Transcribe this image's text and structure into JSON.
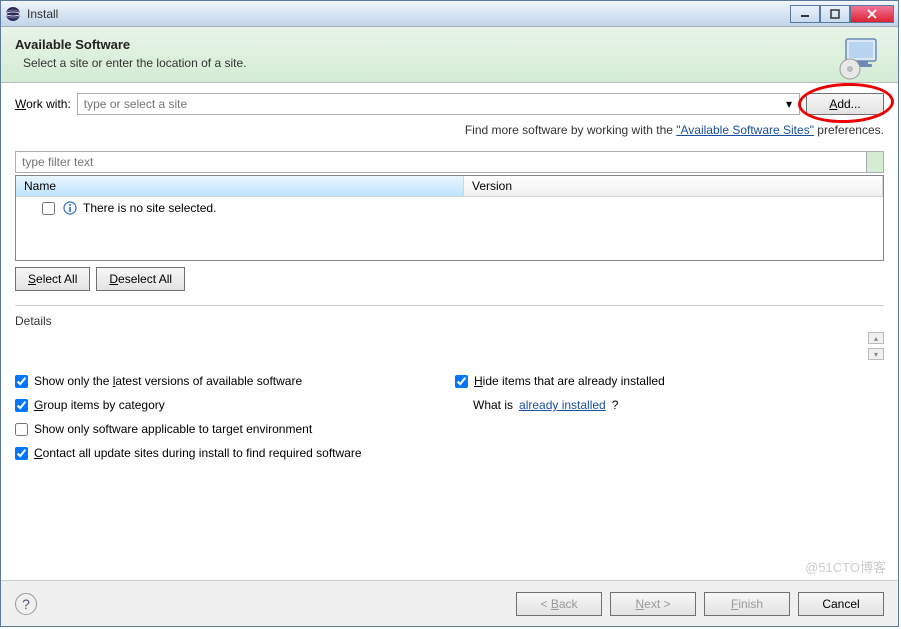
{
  "titlebar": {
    "title": "Install"
  },
  "header": {
    "title": "Available Software",
    "subtitle": "Select a site or enter the location of a site."
  },
  "workwith": {
    "label_pre": "W",
    "label_post": "ork with:",
    "placeholder": "type or select a site",
    "add_pre": "A",
    "add_post": "dd..."
  },
  "tip": {
    "pre": "Find more software by working with the ",
    "link": "\"Available Software Sites\"",
    "post": " preferences."
  },
  "filter": {
    "placeholder": "type filter text"
  },
  "table": {
    "col_name": "Name",
    "col_version": "Version",
    "empty_msg": "There is no site selected."
  },
  "buttons": {
    "select_all_pre": "S",
    "select_all_post": "elect All",
    "deselect_all_pre": "D",
    "deselect_all_post": "eselect All"
  },
  "details": {
    "label": "Details"
  },
  "options": {
    "latest_pre": "Show only the ",
    "latest_u": "l",
    "latest_post": "atest versions of available software",
    "hide_pre": "H",
    "hide_post": "ide items that are already installed",
    "group_pre": "G",
    "group_post": "roup items by category",
    "whatis_pre": "What is ",
    "whatis_link": "already installed",
    "whatis_post": "?",
    "applicable": "Show only software applicable to target environment",
    "contact_pre": "C",
    "contact_post": "ontact all update sites during install to find required software"
  },
  "footer": {
    "back_pre": "< ",
    "back_u": "B",
    "back_post": "ack",
    "next_pre": "N",
    "next_post": "ext >",
    "finish_pre": "F",
    "finish_post": "inish",
    "cancel": "Cancel"
  },
  "watermark": "@51CTO博客"
}
